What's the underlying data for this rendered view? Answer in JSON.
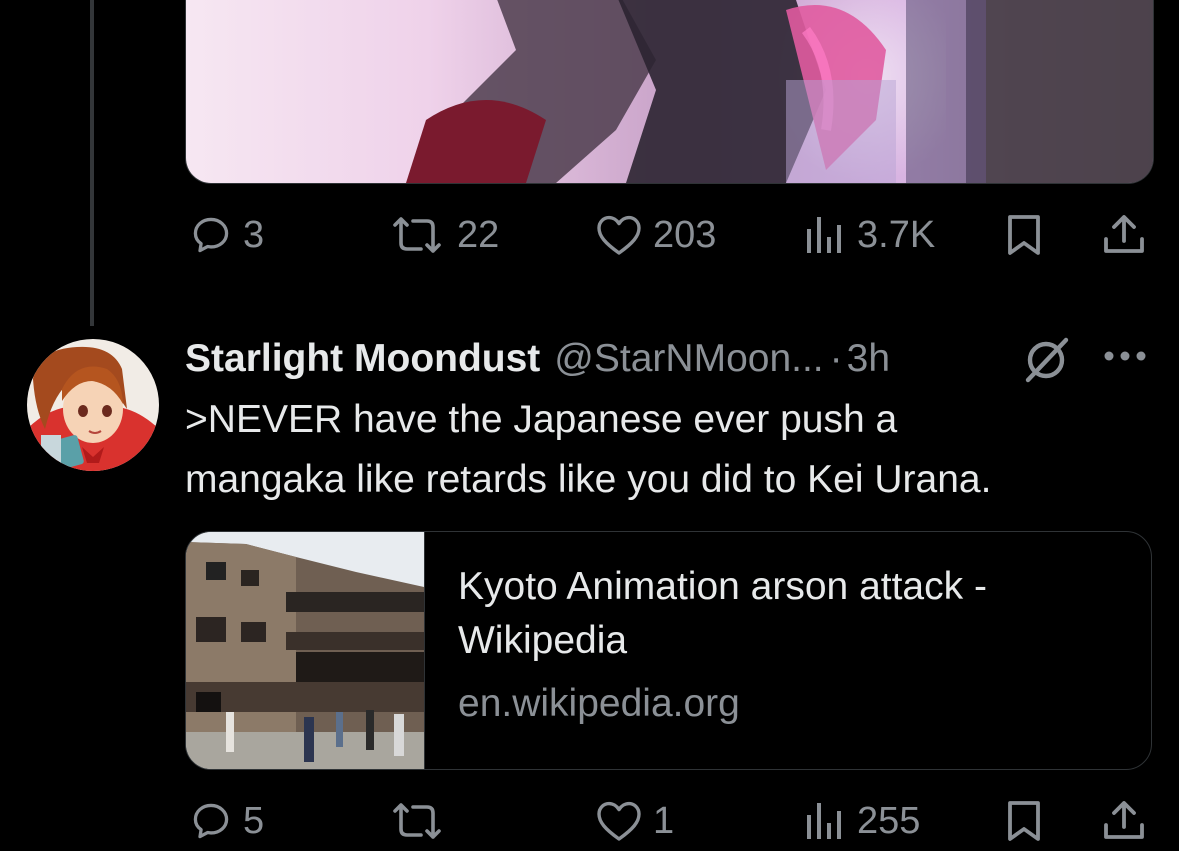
{
  "tweet_prev": {
    "actions": {
      "replies": "3",
      "retweets": "22",
      "likes": "203",
      "views": "3.7K"
    }
  },
  "tweet": {
    "display_name": "Starlight Moondust",
    "handle": "@StarNMoon...",
    "separator": "·",
    "time": "3h",
    "text_line1": ">NEVER have the Japanese ever push a",
    "text_line2": "mangaka like retards like you did to Kei Urana.",
    "card": {
      "title_line1": "Kyoto Animation arson attack -",
      "title_line2": "Wikipedia",
      "domain": "en.wikipedia.org"
    },
    "actions": {
      "replies": "5",
      "retweets": "",
      "likes": "1",
      "views": "255"
    }
  },
  "colors": {
    "background": "#000000",
    "text_primary": "#e7e9ea",
    "text_secondary": "#8b9096",
    "border": "#2f3336"
  },
  "icons": {
    "reply": "reply-icon",
    "retweet": "retweet-icon",
    "like": "heart-icon",
    "views": "views-icon",
    "bookmark": "bookmark-icon",
    "share": "share-icon",
    "muted": "muted-icon",
    "more": "more-icon"
  }
}
